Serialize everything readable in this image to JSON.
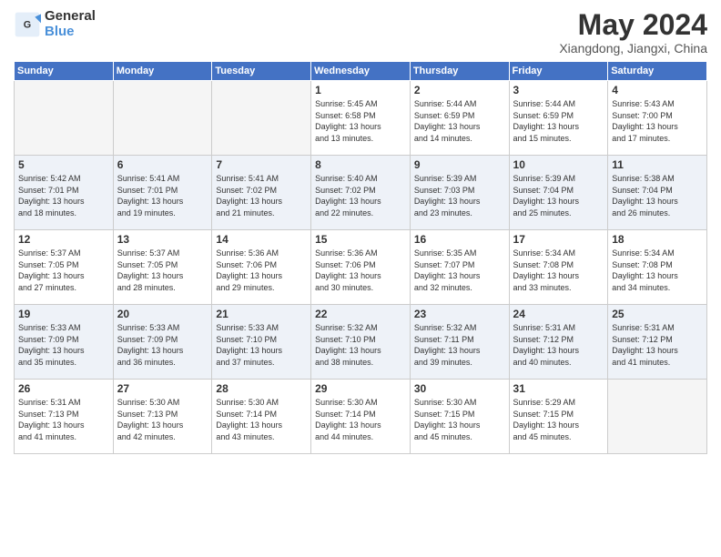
{
  "header": {
    "logo_line1": "General",
    "logo_line2": "Blue",
    "month": "May 2024",
    "location": "Xiangdong, Jiangxi, China"
  },
  "weekdays": [
    "Sunday",
    "Monday",
    "Tuesday",
    "Wednesday",
    "Thursday",
    "Friday",
    "Saturday"
  ],
  "weeks": [
    [
      {
        "day": "",
        "info": ""
      },
      {
        "day": "",
        "info": ""
      },
      {
        "day": "",
        "info": ""
      },
      {
        "day": "1",
        "info": "Sunrise: 5:45 AM\nSunset: 6:58 PM\nDaylight: 13 hours\nand 13 minutes."
      },
      {
        "day": "2",
        "info": "Sunrise: 5:44 AM\nSunset: 6:59 PM\nDaylight: 13 hours\nand 14 minutes."
      },
      {
        "day": "3",
        "info": "Sunrise: 5:44 AM\nSunset: 6:59 PM\nDaylight: 13 hours\nand 15 minutes."
      },
      {
        "day": "4",
        "info": "Sunrise: 5:43 AM\nSunset: 7:00 PM\nDaylight: 13 hours\nand 17 minutes."
      }
    ],
    [
      {
        "day": "5",
        "info": "Sunrise: 5:42 AM\nSunset: 7:01 PM\nDaylight: 13 hours\nand 18 minutes."
      },
      {
        "day": "6",
        "info": "Sunrise: 5:41 AM\nSunset: 7:01 PM\nDaylight: 13 hours\nand 19 minutes."
      },
      {
        "day": "7",
        "info": "Sunrise: 5:41 AM\nSunset: 7:02 PM\nDaylight: 13 hours\nand 21 minutes."
      },
      {
        "day": "8",
        "info": "Sunrise: 5:40 AM\nSunset: 7:02 PM\nDaylight: 13 hours\nand 22 minutes."
      },
      {
        "day": "9",
        "info": "Sunrise: 5:39 AM\nSunset: 7:03 PM\nDaylight: 13 hours\nand 23 minutes."
      },
      {
        "day": "10",
        "info": "Sunrise: 5:39 AM\nSunset: 7:04 PM\nDaylight: 13 hours\nand 25 minutes."
      },
      {
        "day": "11",
        "info": "Sunrise: 5:38 AM\nSunset: 7:04 PM\nDaylight: 13 hours\nand 26 minutes."
      }
    ],
    [
      {
        "day": "12",
        "info": "Sunrise: 5:37 AM\nSunset: 7:05 PM\nDaylight: 13 hours\nand 27 minutes."
      },
      {
        "day": "13",
        "info": "Sunrise: 5:37 AM\nSunset: 7:05 PM\nDaylight: 13 hours\nand 28 minutes."
      },
      {
        "day": "14",
        "info": "Sunrise: 5:36 AM\nSunset: 7:06 PM\nDaylight: 13 hours\nand 29 minutes."
      },
      {
        "day": "15",
        "info": "Sunrise: 5:36 AM\nSunset: 7:06 PM\nDaylight: 13 hours\nand 30 minutes."
      },
      {
        "day": "16",
        "info": "Sunrise: 5:35 AM\nSunset: 7:07 PM\nDaylight: 13 hours\nand 32 minutes."
      },
      {
        "day": "17",
        "info": "Sunrise: 5:34 AM\nSunset: 7:08 PM\nDaylight: 13 hours\nand 33 minutes."
      },
      {
        "day": "18",
        "info": "Sunrise: 5:34 AM\nSunset: 7:08 PM\nDaylight: 13 hours\nand 34 minutes."
      }
    ],
    [
      {
        "day": "19",
        "info": "Sunrise: 5:33 AM\nSunset: 7:09 PM\nDaylight: 13 hours\nand 35 minutes."
      },
      {
        "day": "20",
        "info": "Sunrise: 5:33 AM\nSunset: 7:09 PM\nDaylight: 13 hours\nand 36 minutes."
      },
      {
        "day": "21",
        "info": "Sunrise: 5:33 AM\nSunset: 7:10 PM\nDaylight: 13 hours\nand 37 minutes."
      },
      {
        "day": "22",
        "info": "Sunrise: 5:32 AM\nSunset: 7:10 PM\nDaylight: 13 hours\nand 38 minutes."
      },
      {
        "day": "23",
        "info": "Sunrise: 5:32 AM\nSunset: 7:11 PM\nDaylight: 13 hours\nand 39 minutes."
      },
      {
        "day": "24",
        "info": "Sunrise: 5:31 AM\nSunset: 7:12 PM\nDaylight: 13 hours\nand 40 minutes."
      },
      {
        "day": "25",
        "info": "Sunrise: 5:31 AM\nSunset: 7:12 PM\nDaylight: 13 hours\nand 41 minutes."
      }
    ],
    [
      {
        "day": "26",
        "info": "Sunrise: 5:31 AM\nSunset: 7:13 PM\nDaylight: 13 hours\nand 41 minutes."
      },
      {
        "day": "27",
        "info": "Sunrise: 5:30 AM\nSunset: 7:13 PM\nDaylight: 13 hours\nand 42 minutes."
      },
      {
        "day": "28",
        "info": "Sunrise: 5:30 AM\nSunset: 7:14 PM\nDaylight: 13 hours\nand 43 minutes."
      },
      {
        "day": "29",
        "info": "Sunrise: 5:30 AM\nSunset: 7:14 PM\nDaylight: 13 hours\nand 44 minutes."
      },
      {
        "day": "30",
        "info": "Sunrise: 5:30 AM\nSunset: 7:15 PM\nDaylight: 13 hours\nand 45 minutes."
      },
      {
        "day": "31",
        "info": "Sunrise: 5:29 AM\nSunset: 7:15 PM\nDaylight: 13 hours\nand 45 minutes."
      },
      {
        "day": "",
        "info": ""
      }
    ]
  ]
}
